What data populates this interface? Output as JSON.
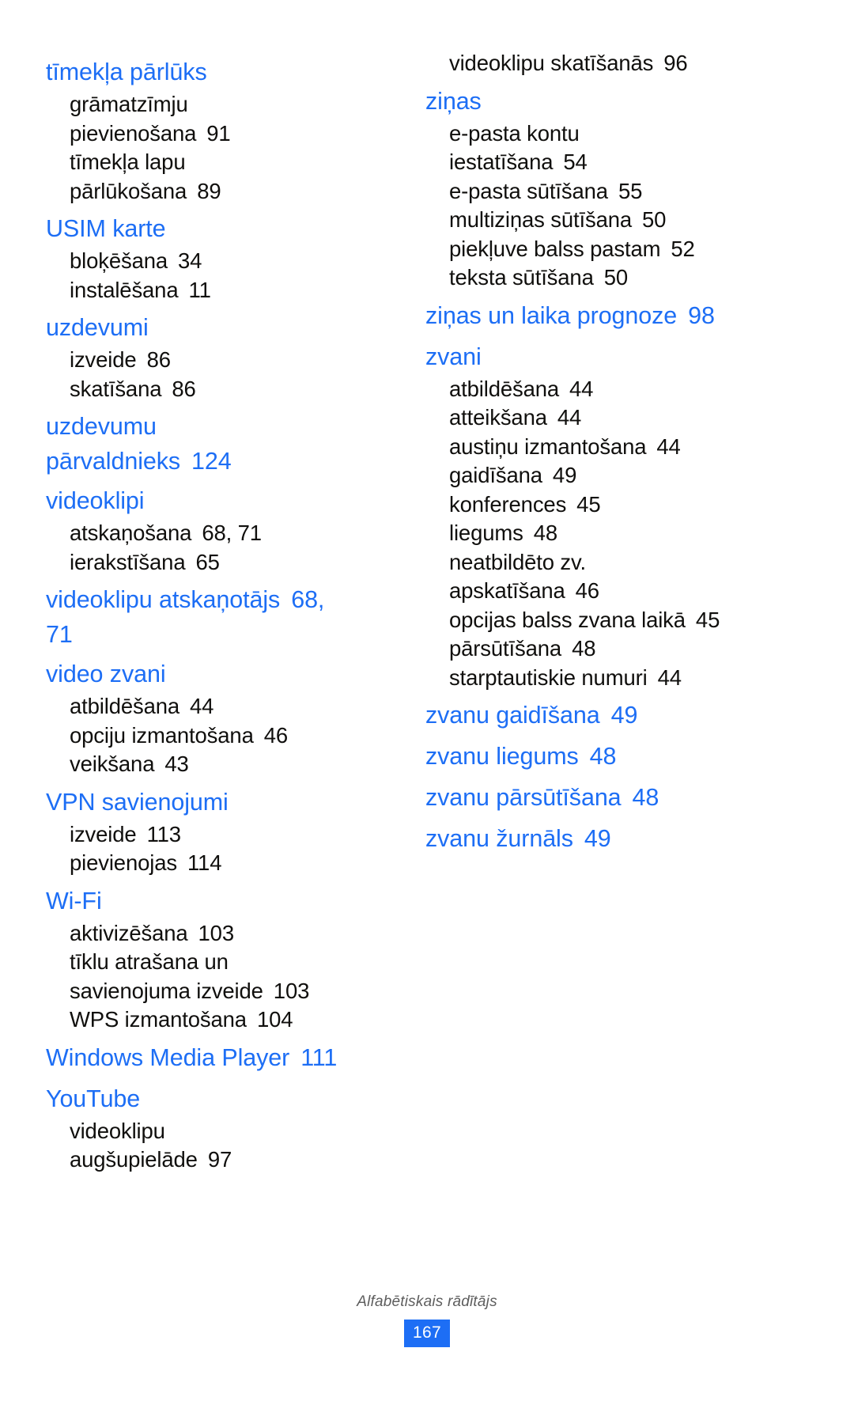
{
  "document": {
    "type": "index",
    "language": "lv",
    "footer_label": "Alfabētiskais rādītājs",
    "page_number": "167",
    "heading_color": "#1d6ef5",
    "body_color": "#100f0d"
  },
  "left_column": {
    "entries": [
      {
        "kind": "heading",
        "title": "tīmekļa pārlūks",
        "page": ""
      },
      {
        "kind": "sub",
        "title": "grāmatzīmju",
        "cont": "pievienošana",
        "page": "91"
      },
      {
        "kind": "sub",
        "title": "tīmekļa lapu",
        "cont": "pārlūkošana",
        "page": "89"
      },
      {
        "kind": "heading",
        "title": "USIM karte",
        "page": ""
      },
      {
        "kind": "sub",
        "title": "bloķēšana",
        "page": "34"
      },
      {
        "kind": "sub",
        "title": "instalēšana",
        "page": "11"
      },
      {
        "kind": "heading",
        "title": "uzdevumi",
        "page": ""
      },
      {
        "kind": "sub",
        "title": "izveide",
        "page": "86"
      },
      {
        "kind": "sub",
        "title": "skatīšana",
        "page": "86"
      },
      {
        "kind": "heading",
        "title": "uzdevumu",
        "cont": "pārvaldnieks",
        "page": "124"
      },
      {
        "kind": "heading",
        "title": "videoklipi",
        "page": ""
      },
      {
        "kind": "sub",
        "title": "atskaņošana",
        "page": "68, 71"
      },
      {
        "kind": "sub",
        "title": "ierakstīšana",
        "page": "65"
      },
      {
        "kind": "heading",
        "title": "videoklipu atskaņotājs",
        "page": "68,",
        "cont_page": "71"
      },
      {
        "kind": "heading",
        "title": "video zvani",
        "page": ""
      },
      {
        "kind": "sub",
        "title": "atbildēšana",
        "page": "44"
      },
      {
        "kind": "sub",
        "title": "opciju izmantošana",
        "page": "46"
      },
      {
        "kind": "sub",
        "title": "veikšana",
        "page": "43"
      },
      {
        "kind": "heading",
        "title": "VPN savienojumi",
        "page": ""
      },
      {
        "kind": "sub",
        "title": "izveide",
        "page": "113"
      },
      {
        "kind": "sub",
        "title": "pievienojas",
        "page": "114"
      },
      {
        "kind": "heading",
        "title": "Wi-Fi",
        "page": ""
      },
      {
        "kind": "sub",
        "title": "aktivizēšana",
        "page": "103"
      },
      {
        "kind": "sub",
        "title": "tīklu atrašana un",
        "cont": "savienojuma izveide",
        "page": "103"
      },
      {
        "kind": "sub",
        "title": "WPS izmantošana",
        "page": "104"
      },
      {
        "kind": "heading",
        "title": "Windows Media Player",
        "page": "111"
      },
      {
        "kind": "heading",
        "title": "YouTube",
        "page": ""
      },
      {
        "kind": "sub",
        "title": "videoklipu",
        "cont": "augšupielāde",
        "page": "97"
      }
    ]
  },
  "right_column": {
    "entries": [
      {
        "kind": "sub",
        "title": "videoklipu skatīšanās",
        "page": "96"
      },
      {
        "kind": "heading",
        "title": "ziņas",
        "page": ""
      },
      {
        "kind": "sub",
        "title": "e-pasta kontu",
        "cont": "iestatīšana",
        "page": "54"
      },
      {
        "kind": "sub",
        "title": "e-pasta sūtīšana",
        "page": "55"
      },
      {
        "kind": "sub",
        "title": "multiziņas sūtīšana",
        "page": "50"
      },
      {
        "kind": "sub",
        "title": "piekļuve balss pastam",
        "page": "52"
      },
      {
        "kind": "sub",
        "title": "teksta sūtīšana",
        "page": "50"
      },
      {
        "kind": "heading",
        "title": "ziņas un laika prognoze",
        "page": "98"
      },
      {
        "kind": "heading",
        "title": "zvani",
        "page": ""
      },
      {
        "kind": "sub",
        "title": "atbildēšana",
        "page": "44"
      },
      {
        "kind": "sub",
        "title": "atteikšana",
        "page": "44"
      },
      {
        "kind": "sub",
        "title": "austiņu izmantošana",
        "page": "44"
      },
      {
        "kind": "sub",
        "title": "gaidīšana",
        "page": "49"
      },
      {
        "kind": "sub",
        "title": "konferences",
        "page": "45"
      },
      {
        "kind": "sub",
        "title": "liegums",
        "page": "48"
      },
      {
        "kind": "sub",
        "title": "neatbildēto zv.",
        "cont": "apskatīšana",
        "page": "46"
      },
      {
        "kind": "sub",
        "title": "opcijas balss zvana laikā",
        "page": "45"
      },
      {
        "kind": "sub",
        "title": "pārsūtīšana",
        "page": "48"
      },
      {
        "kind": "sub",
        "title": "starptautiskie numuri",
        "page": "44"
      },
      {
        "kind": "heading",
        "title": "zvanu gaidīšana",
        "page": "49"
      },
      {
        "kind": "heading",
        "title": "zvanu liegums",
        "page": "48"
      },
      {
        "kind": "heading",
        "title": "zvanu pārsūtīšana",
        "page": "48"
      },
      {
        "kind": "heading",
        "title": "zvanu žurnāls",
        "page": "49"
      }
    ]
  }
}
